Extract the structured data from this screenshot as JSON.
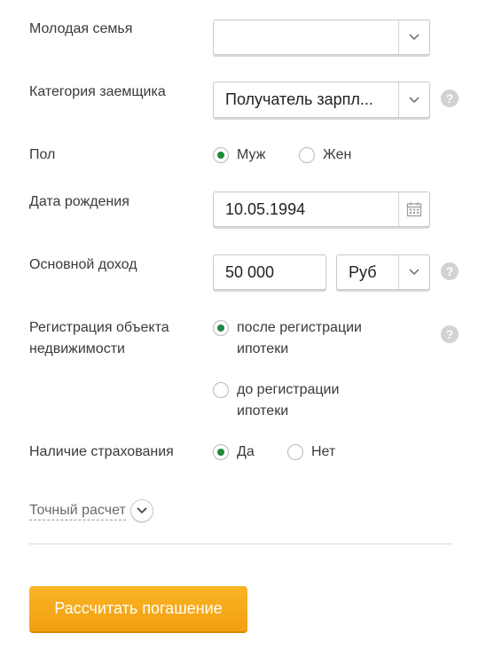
{
  "fields": {
    "young_family": {
      "label": "Молодая семья",
      "value": ""
    },
    "borrower_category": {
      "label": "Категория заемщика",
      "value": "Получатель зарпл..."
    },
    "gender": {
      "label": "Пол",
      "options": [
        {
          "label": "Муж",
          "checked": true
        },
        {
          "label": "Жен",
          "checked": false
        }
      ]
    },
    "birth_date": {
      "label": "Дата рождения",
      "value": "10.05.1994"
    },
    "income": {
      "label": "Основной доход",
      "value": "50 000",
      "currency": "Руб"
    },
    "property_registration": {
      "label_line1": "Регистрация объекта",
      "label_line2": "недвижимости",
      "options": [
        {
          "line1": "после регистрации",
          "line2": "ипотеки",
          "checked": true
        },
        {
          "line1": "до регистрации",
          "line2": "ипотеки",
          "checked": false
        }
      ]
    },
    "insurance": {
      "label": "Наличие страхования",
      "options": [
        {
          "label": "Да",
          "checked": true
        },
        {
          "label": "Нет",
          "checked": false
        }
      ]
    }
  },
  "help_icon_symbol": "?",
  "exact_calc_label": "Точный расчет",
  "submit_label": "Рассчитать погашение",
  "colors": {
    "accent_orange": "#f2a00e",
    "radio_green": "#1e8a3c",
    "help_gray": "#d2d2d2"
  }
}
